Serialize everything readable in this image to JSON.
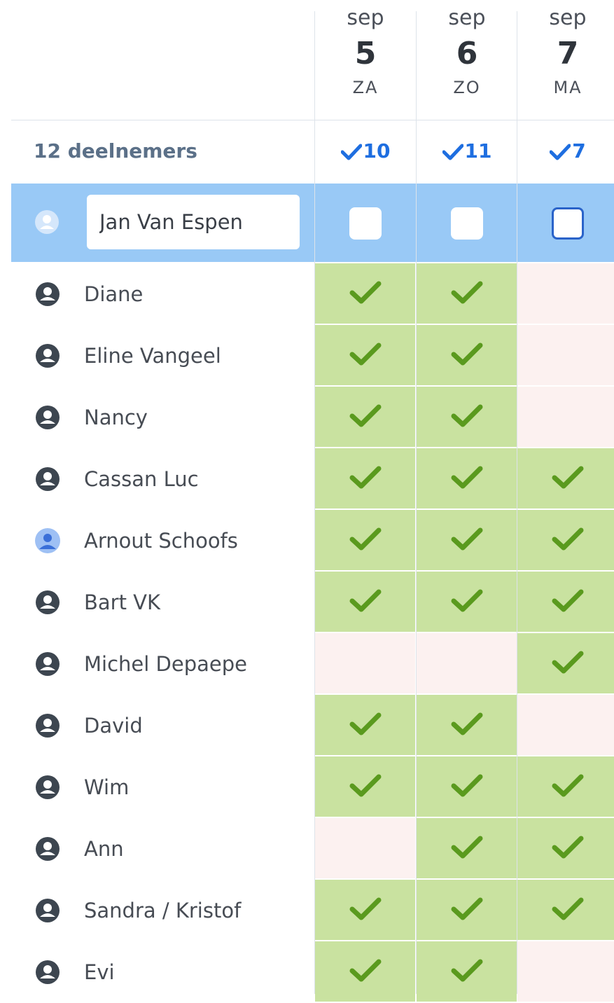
{
  "dates": [
    {
      "month": "sep",
      "day": "5",
      "weekday": "ZA",
      "total": "10"
    },
    {
      "month": "sep",
      "day": "6",
      "weekday": "ZO",
      "total": "11"
    },
    {
      "month": "sep",
      "day": "7",
      "weekday": "MA",
      "total": "7"
    }
  ],
  "participants_count_label": "12 deelnemers",
  "current_user": {
    "name_value": "Jan Van Espen",
    "checkbox_states": [
      false,
      false,
      false
    ]
  },
  "participants": [
    {
      "name": "Diane",
      "avatar": "user-circle-icon",
      "votes": [
        true,
        true,
        false
      ]
    },
    {
      "name": "Eline Vangeel",
      "avatar": "user-circle-icon",
      "votes": [
        true,
        true,
        false
      ]
    },
    {
      "name": "Nancy",
      "avatar": "user-circle-icon",
      "votes": [
        true,
        true,
        false
      ]
    },
    {
      "name": "Cassan Luc",
      "avatar": "user-circle-icon",
      "votes": [
        true,
        true,
        true
      ]
    },
    {
      "name": "Arnout Schoofs",
      "avatar": "user-photo-avatar",
      "votes": [
        true,
        true,
        true
      ]
    },
    {
      "name": "Bart VK",
      "avatar": "user-circle-icon",
      "votes": [
        true,
        true,
        true
      ]
    },
    {
      "name": "Michel Depaepe",
      "avatar": "user-circle-icon",
      "votes": [
        false,
        false,
        true
      ]
    },
    {
      "name": "David",
      "avatar": "user-circle-icon",
      "votes": [
        true,
        true,
        false
      ]
    },
    {
      "name": "Wim",
      "avatar": "user-circle-icon",
      "votes": [
        true,
        true,
        true
      ]
    },
    {
      "name": "Ann",
      "avatar": "user-circle-icon",
      "votes": [
        false,
        true,
        true
      ]
    },
    {
      "name": "Sandra / Kristof",
      "avatar": "user-circle-icon",
      "votes": [
        true,
        true,
        true
      ]
    },
    {
      "name": "Evi",
      "avatar": "user-circle-icon",
      "votes": [
        true,
        true,
        false
      ]
    }
  ],
  "colors": {
    "yes": "#c9e2a0",
    "no": "#fcf1f0",
    "check": "#5a9a1e",
    "accent": "#1e6ee0",
    "self_row": "#99c9f6"
  }
}
